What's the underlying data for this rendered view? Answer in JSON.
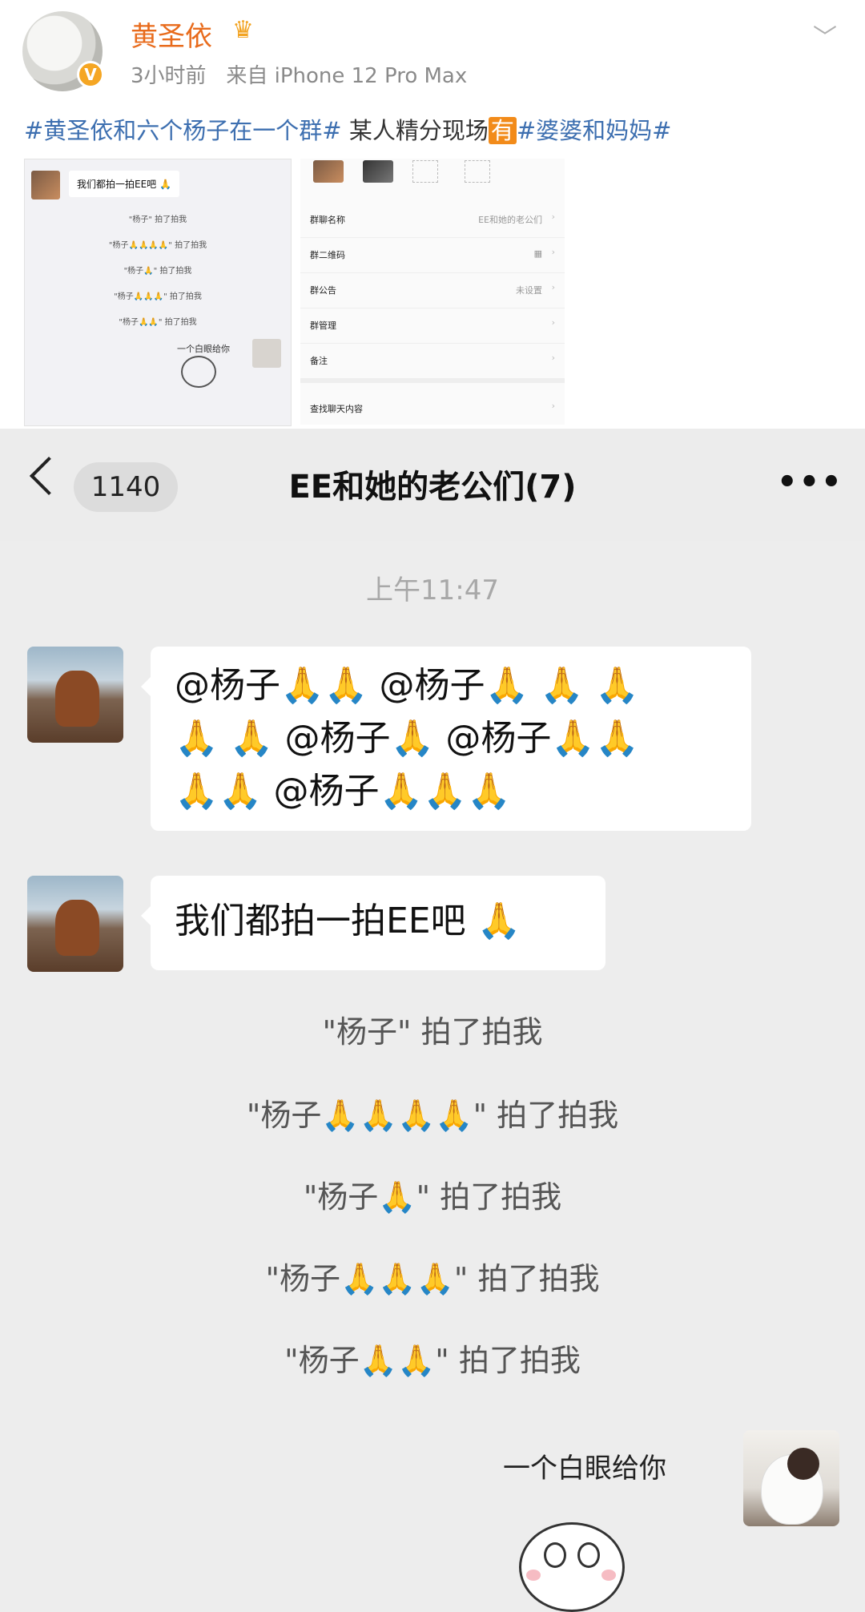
{
  "post": {
    "username": "黄圣依",
    "time": "3小时前",
    "source": "来自 iPhone 12 Pro Max",
    "tags": {
      "tag1": "#黄圣依和六个杨子在一个群#",
      "text": " 某人精分现场",
      "you": "有",
      "tag2": "#婆婆和妈妈#"
    }
  },
  "thumb1": {
    "bubble": "我们都拍一拍EE吧 🙏",
    "lines": [
      "\"杨子\" 拍了拍我",
      "\"杨子🙏🙏🙏🙏\" 拍了拍我",
      "\"杨子🙏\" 拍了拍我",
      "\"杨子🙏🙏🙏\" 拍了拍我",
      "\"杨子🙏🙏\" 拍了拍我"
    ],
    "small": "一个白眼给你"
  },
  "thumb2": {
    "rows": [
      {
        "label": "群聊名称",
        "value": "EE和她的老公们"
      },
      {
        "label": "群二维码",
        "value": ""
      },
      {
        "label": "群公告",
        "value": "未设置"
      },
      {
        "label": "群管理",
        "value": ""
      },
      {
        "label": "备注",
        "value": ""
      },
      {
        "label": "查找聊天内容",
        "value": ""
      }
    ]
  },
  "chat": {
    "unread_count": "1140",
    "title": "EE和她的老公们(7)",
    "more": "•••",
    "time": "上午11:47",
    "msg1": {
      "line1": "@杨子🙏🙏 @杨子🙏 🙏 🙏",
      "line2": "🙏 🙏 @杨子🙏 @杨子🙏🙏",
      "line3": "🙏🙏 @杨子🙏🙏🙏"
    },
    "msg2": "我们都拍一拍EE吧 🙏",
    "pats": [
      "\"杨子\" 拍了拍我",
      "\"杨子🙏🙏🙏🙏\" 拍了拍我",
      "\"杨子🙏\" 拍了拍我",
      "\"杨子🙏🙏🙏\" 拍了拍我",
      "\"杨子🙏🙏\" 拍了拍我"
    ],
    "sticker_text": "一个白眼给你"
  },
  "colors": {
    "username": "#e86b1c",
    "tag": "#3d6fb0",
    "chat_bg": "#ededed",
    "bubble": "#ffffff"
  }
}
